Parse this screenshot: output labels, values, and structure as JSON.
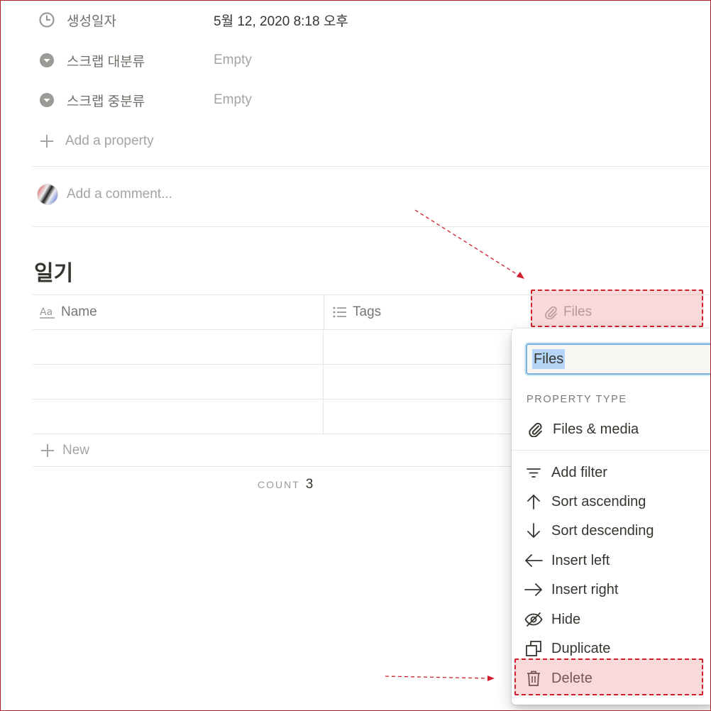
{
  "properties": [
    {
      "icon": "clock-icon",
      "label": "생성일자",
      "value": "5월 12, 2020 8:18 오후",
      "empty": false
    },
    {
      "icon": "select-icon",
      "label": "스크랩 대분류",
      "value": "Empty",
      "empty": true
    },
    {
      "icon": "select-icon",
      "label": "스크랩 중분류",
      "value": "Empty",
      "empty": true
    }
  ],
  "add_property": "Add a property",
  "comment_placeholder": "Add a comment...",
  "database": {
    "title": "일기",
    "columns": [
      {
        "name": "Name",
        "icon": "text-aa-icon"
      },
      {
        "name": "Tags",
        "icon": "list-icon"
      },
      {
        "name": "Files",
        "icon": "paperclip-icon"
      }
    ],
    "row_count": 3,
    "new_label": "New",
    "count_label": "COUNT",
    "count_value": "3"
  },
  "menu": {
    "property_name": "Files",
    "section_label": "PROPERTY TYPE",
    "type_label": "Files & media",
    "items": [
      {
        "label": "Add filter",
        "icon": "filter-icon"
      },
      {
        "label": "Sort ascending",
        "icon": "arrow-up-icon"
      },
      {
        "label": "Sort descending",
        "icon": "arrow-down-icon"
      },
      {
        "label": "Insert left",
        "icon": "arrow-left-icon"
      },
      {
        "label": "Insert right",
        "icon": "arrow-right-icon"
      },
      {
        "label": "Hide",
        "icon": "eye-off-icon"
      },
      {
        "label": "Duplicate",
        "icon": "duplicate-icon"
      },
      {
        "label": "Delete",
        "icon": "trash-icon"
      }
    ]
  },
  "colors": {
    "annotation": "#d01e2c",
    "highlight_fill": "#f5d6d6",
    "input_focus": "#7fb2d9"
  }
}
